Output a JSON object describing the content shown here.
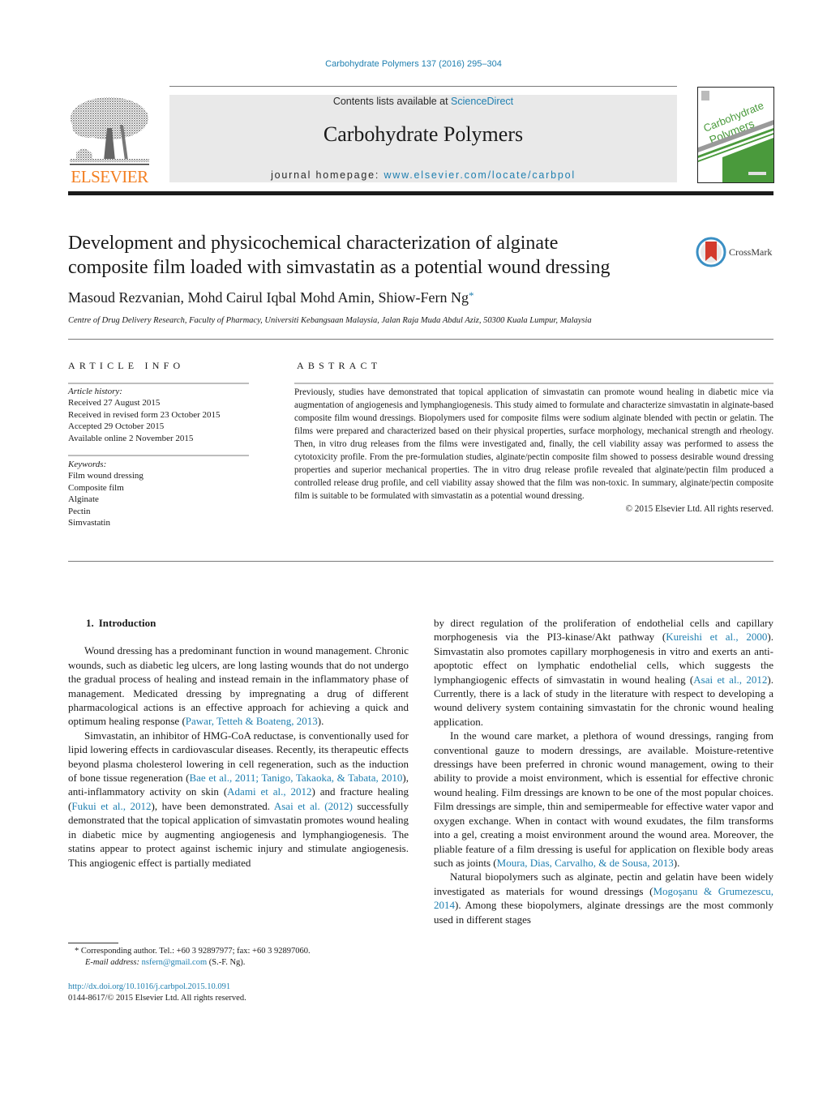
{
  "citation": "Carbohydrate Polymers 137 (2016) 295–304",
  "header": {
    "publisher_logo_text": "ELSEVIER",
    "contents_prefix": "Contents lists available at ",
    "contents_link": "ScienceDirect",
    "journal_title": "Carbohydrate Polymers",
    "homepage_prefix": "journal homepage: ",
    "homepage_link": "www.elsevier.com/locate/carbpol",
    "cover_title_line1": "Carbohydrate",
    "cover_title_line2": "Polymers",
    "colors": {
      "link": "#1f7fb0",
      "elsevier_orange": "#f37f21",
      "cover_green": "#4a9a3c",
      "header_bg": "#e9e9e9"
    }
  },
  "article": {
    "title_line1": "Development and physicochemical characterization of alginate",
    "title_line2": "composite film loaded with simvastatin as a potential wound dressing",
    "crossmark_label": "CrossMark",
    "authors": "Masoud Rezvanian, Mohd Cairul Iqbal Mohd Amin, Shiow-Fern Ng",
    "corresponding_marker": "*",
    "affiliation": "Centre of Drug Delivery Research, Faculty of Pharmacy, Universiti Kebangsaan Malaysia, Jalan Raja Muda Abdul Aziz, 50300 Kuala Lumpur, Malaysia"
  },
  "article_info": {
    "heading": "ARTICLE INFO",
    "history_label": "Article history:",
    "history": [
      "Received 27 August 2015",
      "Received in revised form 23 October 2015",
      "Accepted 29 October 2015",
      "Available online 2 November 2015"
    ],
    "keywords_label": "Keywords:",
    "keywords": [
      "Film wound dressing",
      "Composite film",
      "Alginate",
      "Pectin",
      "Simvastatin"
    ]
  },
  "abstract": {
    "heading": "ABSTRACT",
    "text": "Previously, studies have demonstrated that topical application of simvastatin can promote wound healing in diabetic mice via augmentation of angiogenesis and lymphangiogenesis. This study aimed to formulate and characterize simvastatin in alginate-based composite film wound dressings. Biopolymers used for composite films were sodium alginate blended with pectin or gelatin. The films were prepared and characterized based on their physical properties, surface morphology, mechanical strength and rheology. Then, in vitro drug releases from the films were investigated and, finally, the cell viability assay was performed to assess the cytotoxicity profile. From the pre-formulation studies, alginate/pectin composite film showed to possess desirable wound dressing properties and superior mechanical properties. The in vitro drug release profile revealed that alginate/pectin film produced a controlled release drug profile, and cell viability assay showed that the film was non-toxic. In summary, alginate/pectin composite film is suitable to be formulated with simvastatin as a potential wound dressing.",
    "copyright": "© 2015 Elsevier Ltd. All rights reserved."
  },
  "body": {
    "section_number": "1.",
    "section_title": "Introduction",
    "p1": {
      "t1": "Wound dressing has a predominant function in wound management. Chronic wounds, such as diabetic leg ulcers, are long lasting wounds that do not undergo the gradual process of healing and instead remain in the inflammatory phase of management. Medicated dressing by impregnating a drug of different pharmacological actions is an effective approach for achieving a quick and optimum healing response (",
      "c1": "Pawar, Tetteh & Boateng, 2013",
      "t2": ")."
    },
    "p2": {
      "t1": "Simvastatin, an inhibitor of HMG-CoA reductase, is conventionally used for lipid lowering effects in cardiovascular diseases. Recently, its therapeutic effects beyond plasma cholesterol lowering in cell regeneration, such as the induction of bone tissue regeneration (",
      "c1": "Bae et al., 2011; Tanigo, Takaoka, & Tabata, 2010",
      "t2": "), anti-inflammatory activity on skin (",
      "c2": "Adami et al., 2012",
      "t3": ") and fracture healing (",
      "c3": "Fukui et al., 2012",
      "t4": "), have been demonstrated. ",
      "c4": "Asai et al. (2012)",
      "t5": " successfully demonstrated that the topical application of simvastatin promotes wound healing in diabetic mice by augmenting angiogenesis and lymphangiogenesis. The statins appear to protect against ischemic injury and stimulate angiogenesis. This angiogenic effect is partially mediated"
    },
    "p3": {
      "t1": "by direct regulation of the proliferation of endothelial cells and capillary morphogenesis via the PI3-kinase/Akt pathway (",
      "c1": "Kureishi et al., 2000",
      "t2": "). Simvastatin also promotes capillary morphogenesis in vitro and exerts an anti-apoptotic effect on lymphatic endothelial cells, which suggests the lymphangiogenic effects of simvastatin in wound healing (",
      "c2": "Asai et al., 2012",
      "t3": "). Currently, there is a lack of study in the literature with respect to developing a wound delivery system containing simvastatin for the chronic wound healing application."
    },
    "p4": {
      "t1": "In the wound care market, a plethora of wound dressings, ranging from conventional gauze to modern dressings, are available. Moisture-retentive dressings have been preferred in chronic wound management, owing to their ability to provide a moist environment, which is essential for effective chronic wound healing. Film dressings are known to be one of the most popular choices. Film dressings are simple, thin and semipermeable for effective water vapor and oxygen exchange. When in contact with wound exudates, the film transforms into a gel, creating a moist environment around the wound area. Moreover, the pliable feature of a film dressing is useful for application on flexible body areas such as joints (",
      "c1": "Moura, Dias, Carvalho, & de Sousa, 2013",
      "t2": ")."
    },
    "p5": {
      "t1": "Natural biopolymers such as alginate, pectin and gelatin have been widely investigated as materials for wound dressings (",
      "c1": "Mogoşanu & Grumezescu, 2014",
      "t2": "). Among these biopolymers, alginate dressings are the most commonly used in different stages"
    }
  },
  "footnote": {
    "marker": "*",
    "text": " Corresponding author. Tel.: +60 3 92897977; fax: +60 3 92897060.",
    "email_label": "E-mail address: ",
    "email": "nsfern@gmail.com",
    "email_suffix": " (S.-F. Ng)."
  },
  "doi": {
    "url": "http://dx.doi.org/10.1016/j.carbpol.2015.10.091",
    "issn_line": "0144-8617/© 2015 Elsevier Ltd. All rights reserved."
  }
}
